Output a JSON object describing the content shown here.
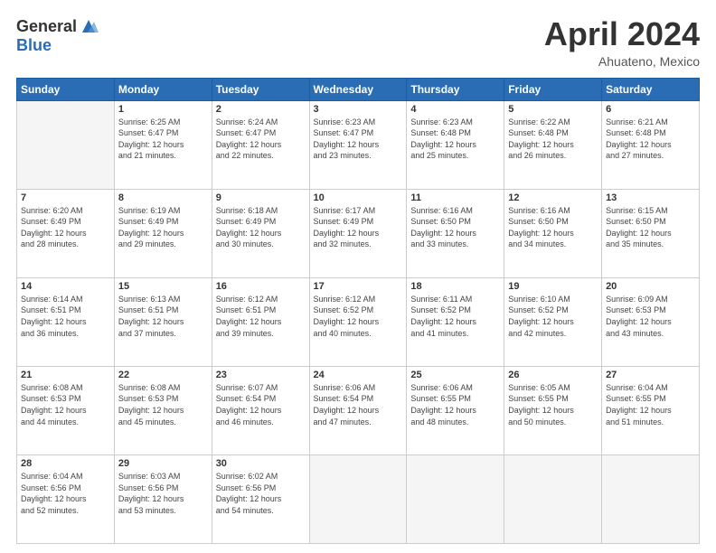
{
  "logo": {
    "general": "General",
    "blue": "Blue"
  },
  "title": {
    "month": "April 2024",
    "location": "Ahuateno, Mexico"
  },
  "calendar": {
    "headers": [
      "Sunday",
      "Monday",
      "Tuesday",
      "Wednesday",
      "Thursday",
      "Friday",
      "Saturday"
    ],
    "weeks": [
      [
        {
          "day": "",
          "info": ""
        },
        {
          "day": "1",
          "info": "Sunrise: 6:25 AM\nSunset: 6:47 PM\nDaylight: 12 hours\nand 21 minutes."
        },
        {
          "day": "2",
          "info": "Sunrise: 6:24 AM\nSunset: 6:47 PM\nDaylight: 12 hours\nand 22 minutes."
        },
        {
          "day": "3",
          "info": "Sunrise: 6:23 AM\nSunset: 6:47 PM\nDaylight: 12 hours\nand 23 minutes."
        },
        {
          "day": "4",
          "info": "Sunrise: 6:23 AM\nSunset: 6:48 PM\nDaylight: 12 hours\nand 25 minutes."
        },
        {
          "day": "5",
          "info": "Sunrise: 6:22 AM\nSunset: 6:48 PM\nDaylight: 12 hours\nand 26 minutes."
        },
        {
          "day": "6",
          "info": "Sunrise: 6:21 AM\nSunset: 6:48 PM\nDaylight: 12 hours\nand 27 minutes."
        }
      ],
      [
        {
          "day": "7",
          "info": "Sunrise: 6:20 AM\nSunset: 6:49 PM\nDaylight: 12 hours\nand 28 minutes."
        },
        {
          "day": "8",
          "info": "Sunrise: 6:19 AM\nSunset: 6:49 PM\nDaylight: 12 hours\nand 29 minutes."
        },
        {
          "day": "9",
          "info": "Sunrise: 6:18 AM\nSunset: 6:49 PM\nDaylight: 12 hours\nand 30 minutes."
        },
        {
          "day": "10",
          "info": "Sunrise: 6:17 AM\nSunset: 6:49 PM\nDaylight: 12 hours\nand 32 minutes."
        },
        {
          "day": "11",
          "info": "Sunrise: 6:16 AM\nSunset: 6:50 PM\nDaylight: 12 hours\nand 33 minutes."
        },
        {
          "day": "12",
          "info": "Sunrise: 6:16 AM\nSunset: 6:50 PM\nDaylight: 12 hours\nand 34 minutes."
        },
        {
          "day": "13",
          "info": "Sunrise: 6:15 AM\nSunset: 6:50 PM\nDaylight: 12 hours\nand 35 minutes."
        }
      ],
      [
        {
          "day": "14",
          "info": "Sunrise: 6:14 AM\nSunset: 6:51 PM\nDaylight: 12 hours\nand 36 minutes."
        },
        {
          "day": "15",
          "info": "Sunrise: 6:13 AM\nSunset: 6:51 PM\nDaylight: 12 hours\nand 37 minutes."
        },
        {
          "day": "16",
          "info": "Sunrise: 6:12 AM\nSunset: 6:51 PM\nDaylight: 12 hours\nand 39 minutes."
        },
        {
          "day": "17",
          "info": "Sunrise: 6:12 AM\nSunset: 6:52 PM\nDaylight: 12 hours\nand 40 minutes."
        },
        {
          "day": "18",
          "info": "Sunrise: 6:11 AM\nSunset: 6:52 PM\nDaylight: 12 hours\nand 41 minutes."
        },
        {
          "day": "19",
          "info": "Sunrise: 6:10 AM\nSunset: 6:52 PM\nDaylight: 12 hours\nand 42 minutes."
        },
        {
          "day": "20",
          "info": "Sunrise: 6:09 AM\nSunset: 6:53 PM\nDaylight: 12 hours\nand 43 minutes."
        }
      ],
      [
        {
          "day": "21",
          "info": "Sunrise: 6:08 AM\nSunset: 6:53 PM\nDaylight: 12 hours\nand 44 minutes."
        },
        {
          "day": "22",
          "info": "Sunrise: 6:08 AM\nSunset: 6:53 PM\nDaylight: 12 hours\nand 45 minutes."
        },
        {
          "day": "23",
          "info": "Sunrise: 6:07 AM\nSunset: 6:54 PM\nDaylight: 12 hours\nand 46 minutes."
        },
        {
          "day": "24",
          "info": "Sunrise: 6:06 AM\nSunset: 6:54 PM\nDaylight: 12 hours\nand 47 minutes."
        },
        {
          "day": "25",
          "info": "Sunrise: 6:06 AM\nSunset: 6:55 PM\nDaylight: 12 hours\nand 48 minutes."
        },
        {
          "day": "26",
          "info": "Sunrise: 6:05 AM\nSunset: 6:55 PM\nDaylight: 12 hours\nand 50 minutes."
        },
        {
          "day": "27",
          "info": "Sunrise: 6:04 AM\nSunset: 6:55 PM\nDaylight: 12 hours\nand 51 minutes."
        }
      ],
      [
        {
          "day": "28",
          "info": "Sunrise: 6:04 AM\nSunset: 6:56 PM\nDaylight: 12 hours\nand 52 minutes."
        },
        {
          "day": "29",
          "info": "Sunrise: 6:03 AM\nSunset: 6:56 PM\nDaylight: 12 hours\nand 53 minutes."
        },
        {
          "day": "30",
          "info": "Sunrise: 6:02 AM\nSunset: 6:56 PM\nDaylight: 12 hours\nand 54 minutes."
        },
        {
          "day": "",
          "info": ""
        },
        {
          "day": "",
          "info": ""
        },
        {
          "day": "",
          "info": ""
        },
        {
          "day": "",
          "info": ""
        }
      ]
    ]
  }
}
